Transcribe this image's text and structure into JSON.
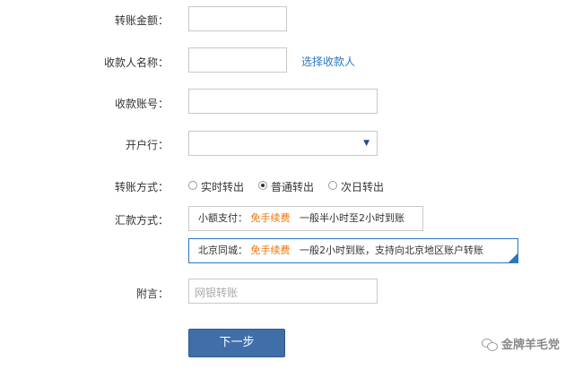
{
  "form": {
    "amount_label": "转账金额：",
    "payee_name_label": "收款人名称：",
    "select_payee_link": "选择收款人",
    "account_label": "收款账号：",
    "bank_label": "开户行：",
    "method_label": "转账方式：",
    "methods": [
      {
        "label": "实时转出",
        "checked": false
      },
      {
        "label": "普通转出",
        "checked": true
      },
      {
        "label": "次日转出",
        "checked": false
      }
    ],
    "remit_label": "汇款方式：",
    "remit_options": [
      {
        "name": "小额支付：",
        "fee": "免手续费",
        "desc": "一般半小时至2小时到账",
        "selected": false
      },
      {
        "name": "北京同城：",
        "fee": "免手续费",
        "desc": "一般2小时到账，支持向北京地区账户转账",
        "selected": true
      }
    ],
    "memo_label": "附言：",
    "memo_placeholder": "网银转账",
    "next_button": "下一步"
  },
  "watermark": {
    "text": "金牌羊毛党"
  },
  "colors": {
    "accent": "#2b76c1",
    "orange": "#f0750a",
    "button": "#3f6ea8"
  },
  "icons": {
    "select_arrow": "chevron-down-icon",
    "selected_corner": "checkmark-icon",
    "watermark_logo": "wechat-icon"
  }
}
